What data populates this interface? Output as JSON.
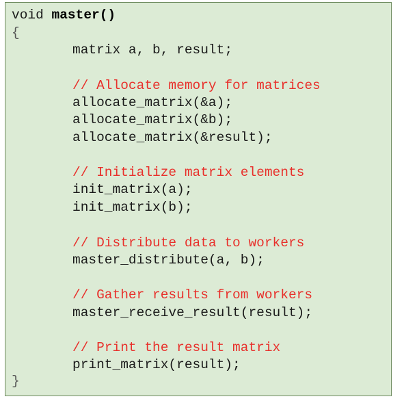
{
  "code": {
    "signature_prefix": "void ",
    "function_name": "master",
    "signature_parens": "()",
    "open_brace": "{",
    "declaration": "matrix a, b, result;",
    "comment_allocate": "// Allocate memory for matrices",
    "alloc_a": "allocate_matrix(&a);",
    "alloc_b": "allocate_matrix(&b);",
    "alloc_result": "allocate_matrix(&result);",
    "comment_init": "// Initialize matrix elements",
    "init_a": "init_matrix(a);",
    "init_b": "init_matrix(b);",
    "comment_distribute": "// Distribute data to workers",
    "distribute_call": "master_distribute(a, b);",
    "comment_gather": "// Gather results from workers",
    "receive_call": "master_receive_result(result);",
    "comment_print": "// Print the result matrix",
    "print_call": "print_matrix(result);",
    "close_brace": "}"
  },
  "colors": {
    "background": "#dcebd5",
    "border": "#6d8a5e",
    "comment": "#e8302b",
    "code": "#1a1a1a"
  }
}
